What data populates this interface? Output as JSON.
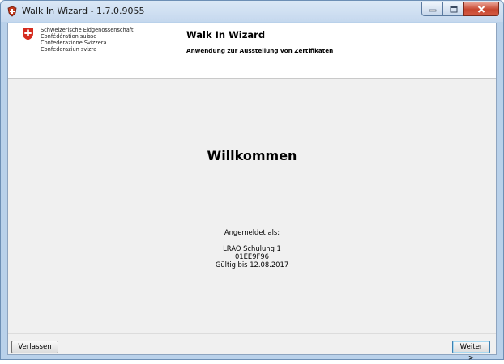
{
  "window": {
    "title": "Walk In Wizard - 1.7.0.9055",
    "icon": "app-shield-icon"
  },
  "header": {
    "confederation_lines": [
      "Schweizerische Eidgenossenschaft",
      "Confédération suisse",
      "Confederazione Svizzera",
      "Confederaziun svizra"
    ],
    "app_title": "Walk In Wizard",
    "app_subtitle": "Anwendung zur Ausstellung von Zertifikaten"
  },
  "main": {
    "welcome": "Willkommen",
    "logged_in_label": "Angemeldet als:",
    "user_name": "LRAO Schulung 1",
    "user_id": "01EE9F96",
    "valid_until": "Gültig bis 12.08.2017"
  },
  "footer": {
    "quit_label": "Verlassen",
    "next_label": "Weiter >"
  },
  "colors": {
    "flag_red": "#d52b1e",
    "window_frame": "#b9d1ea",
    "close_button": "#c7462f"
  }
}
